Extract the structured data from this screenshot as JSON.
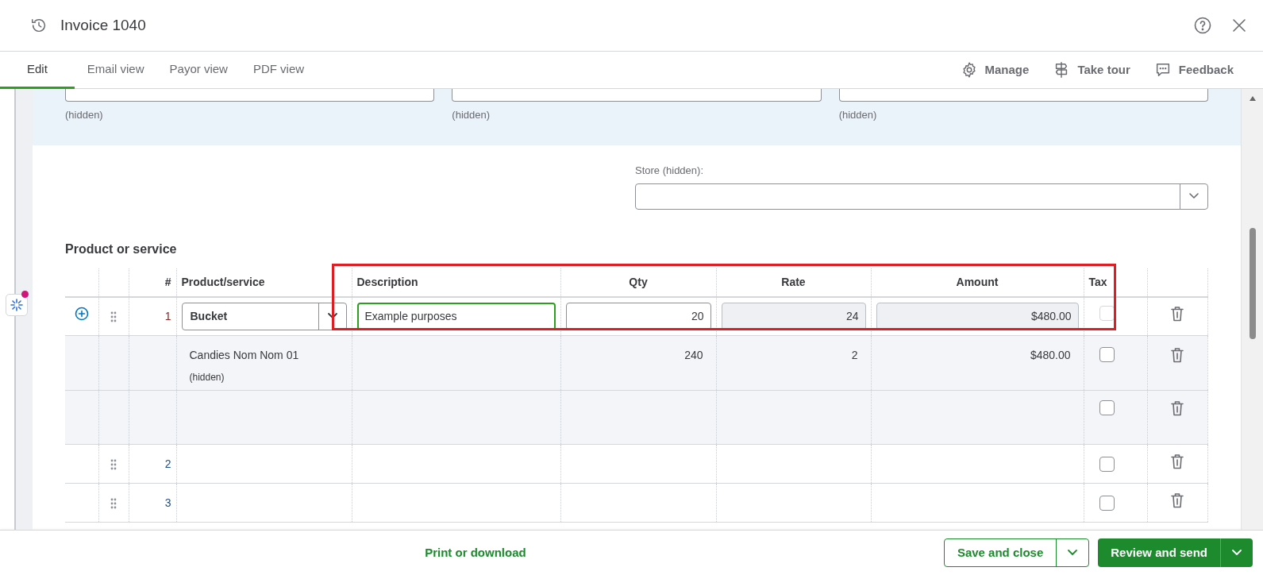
{
  "window": {
    "title": "Invoice 1040"
  },
  "tabs": [
    {
      "label": "Edit",
      "selected": true
    },
    {
      "label": "Email view",
      "selected": false
    },
    {
      "label": "Payor view",
      "selected": false
    },
    {
      "label": "PDF view",
      "selected": false
    }
  ],
  "toolbar": [
    {
      "kind": "manage",
      "label": "Manage"
    },
    {
      "kind": "tour",
      "label": "Take tour"
    },
    {
      "kind": "feedback",
      "label": "Feedback"
    }
  ],
  "top_fields": [
    {
      "hint": "(hidden)"
    },
    {
      "hint": "(hidden)"
    },
    {
      "hint": "(hidden)"
    }
  ],
  "store": {
    "label": "Store (hidden):"
  },
  "section_title": "Product or service",
  "table": {
    "columns": [
      "#",
      "Product/service",
      "Description",
      "Qty",
      "Rate",
      "Amount",
      "Tax"
    ],
    "rows": [
      {
        "kind": "item",
        "number": "1",
        "product": "Bucket",
        "description": "Example purposes",
        "qty": "20",
        "rate": "24",
        "amount": "$480.00",
        "tax_checked": false,
        "tax_disabled": true
      },
      {
        "kind": "detail",
        "product": "Candies Nom Nom 01",
        "note": "(hidden)",
        "qty": "240",
        "rate": "2",
        "amount": "$480.00",
        "tax_checked": false,
        "tax_disabled": false
      },
      {
        "kind": "blank",
        "tax_checked": false,
        "tax_disabled": false
      },
      {
        "kind": "line",
        "number": "2",
        "tax_checked": false,
        "tax_disabled": false
      },
      {
        "kind": "line",
        "number": "3",
        "tax_checked": false,
        "tax_disabled": false
      }
    ]
  },
  "footer": {
    "print_link": "Print or download",
    "save_button": "Save and close",
    "send_button": "Review and send"
  }
}
